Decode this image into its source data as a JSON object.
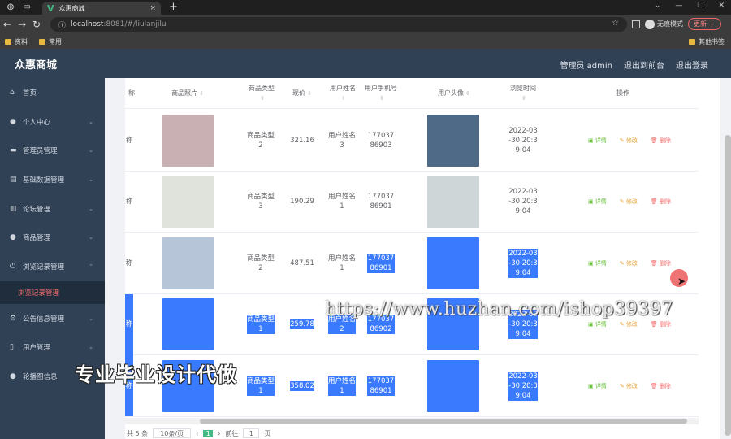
{
  "browser": {
    "tab_title": "众惠商城",
    "tab_close": "×",
    "new_tab": "+",
    "url_host": "localhost",
    "url_rest": ":8081/#/liulanjilu",
    "profile_label": "无痕模式",
    "update_label": "更新",
    "bookmarks": [
      "资料",
      "常用"
    ],
    "other_bookmarks": "其他书签"
  },
  "header": {
    "title": "众惠商城",
    "admin_label": "管理员 admin",
    "back_label": "退出到前台",
    "logout_label": "退出登录"
  },
  "sidebar": {
    "items": [
      {
        "label": "首页",
        "icon": "home-icon",
        "arrow": false
      },
      {
        "label": "个人中心",
        "icon": "user-icon",
        "arrow": true
      },
      {
        "label": "管理员管理",
        "icon": "card-icon",
        "arrow": true
      },
      {
        "label": "基础数据管理",
        "icon": "doc-icon",
        "arrow": true
      },
      {
        "label": "论坛管理",
        "icon": "chart-icon",
        "arrow": true
      },
      {
        "label": "商品管理",
        "icon": "user-icon",
        "arrow": true
      },
      {
        "label": "浏览记录管理",
        "icon": "power-icon",
        "arrow": true,
        "open": true
      },
      {
        "label": "公告信息管理",
        "icon": "settings-icon",
        "arrow": true
      },
      {
        "label": "用户管理",
        "icon": "phone-icon",
        "arrow": true
      },
      {
        "label": "轮播图信息",
        "icon": "user-icon",
        "arrow": false
      }
    ],
    "sub_item": "浏览记录管理"
  },
  "table": {
    "columns": [
      "称",
      "商品照片",
      "商品类型",
      "现价",
      "用户姓名",
      "用户手机号",
      "用户头像",
      "浏览时间",
      "操作"
    ],
    "rows": [
      {
        "name": "称",
        "type": "商品类型2",
        "price": "321.16",
        "uname": "用户姓名3",
        "phone": "17703786903",
        "time": "2022-03-30 20:39:04",
        "img": "#c9b1b3",
        "avatar": "#4f6a86",
        "selected": false
      },
      {
        "name": "称",
        "type": "商品类型3",
        "price": "190.29",
        "uname": "用户姓名1",
        "phone": "17703786901",
        "time": "2022-03-30 20:39:04",
        "img": "#dfe3dc",
        "avatar": "#cfd6d8",
        "selected": false
      },
      {
        "name": "称",
        "type": "商品类型2",
        "price": "487.51",
        "uname": "用户姓名1",
        "phone": "17703786901",
        "time": "2022-03-30 20:39:04",
        "img": "#b6c5d8",
        "avatar": "#3a7afe",
        "selected": "partial"
      },
      {
        "name": "称",
        "type": "商品类型1",
        "price": "259.78",
        "uname": "用户姓名2",
        "phone": "17703786902",
        "time": "2022-03-30 20:39:04",
        "img": "#3a7afe",
        "avatar": "#3a7afe",
        "selected": true
      },
      {
        "name": "称",
        "type": "商品类型1",
        "price": "358.02",
        "uname": "用户姓名1",
        "phone": "17703786901",
        "time": "2022-03-30 20:39:04",
        "img": "#3a7afe",
        "avatar": "#3a7afe",
        "selected": true
      }
    ],
    "ops": {
      "detail": "详情",
      "edit": "修改",
      "delete": "删除"
    }
  },
  "pager": {
    "total": "共 5 条",
    "size": "10条/页",
    "prev": "‹",
    "page": "1",
    "next": "›",
    "goto": "前往",
    "goto_value": "1",
    "page_unit": "页"
  },
  "watermark": {
    "url": "https://www.huzhan.com/ishop39397",
    "cn": "专业毕业设计代做"
  },
  "colors": {
    "header_bg": "#304156",
    "selection": "#3a7afe",
    "detail": "#67c23a",
    "edit": "#e6a23c",
    "delete": "#f56c6c"
  }
}
